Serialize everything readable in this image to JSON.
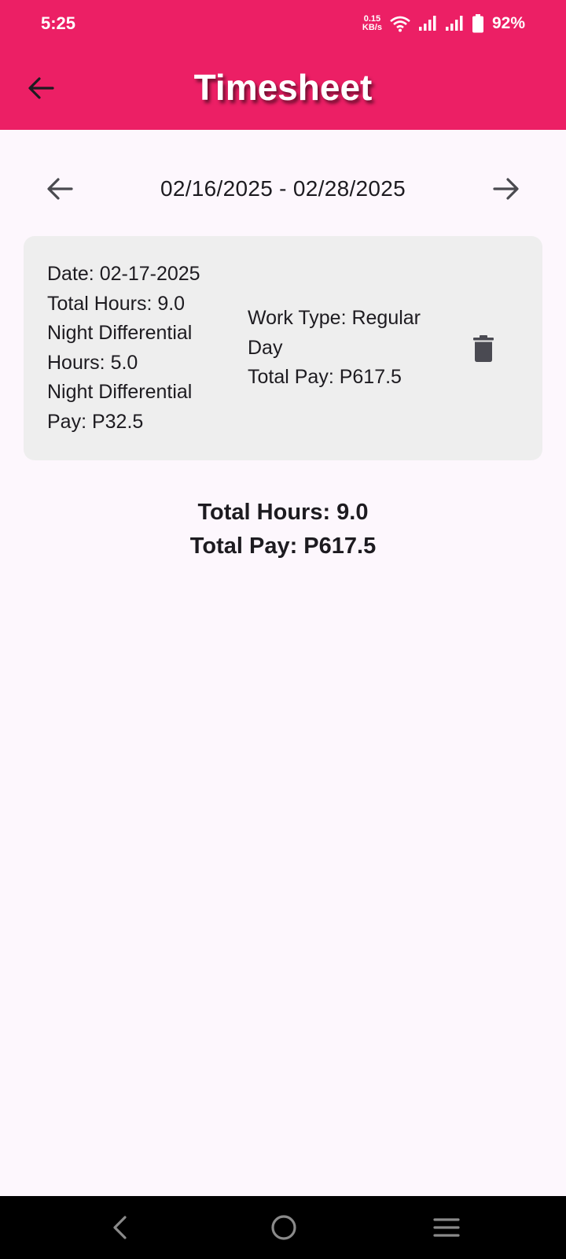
{
  "status_bar": {
    "time": "5:25",
    "net_speed_value": "0.15",
    "net_speed_unit": "KB/s",
    "battery": "92%",
    "icons": [
      "wifi-icon",
      "signal-icon",
      "signal-icon",
      "battery-icon"
    ]
  },
  "header": {
    "title": "Timesheet",
    "back_icon": "arrow-back-icon",
    "background": "#ec1f65"
  },
  "period": {
    "range": "02/16/2025 - 02/28/2025",
    "prev_icon": "arrow-back-icon",
    "next_icon": "arrow-forward-icon"
  },
  "entries": [
    {
      "date": "Date: 02-17-2025",
      "total_hours": "Total Hours: 9.0",
      "nd_hours": "Night Differential Hours: 5.0",
      "nd_pay": "Night Differential Pay: P32.5",
      "work_type": "Work Type: Regular Day",
      "total_pay": "Total Pay: P617.5",
      "delete_icon": "trash-icon"
    }
  ],
  "summary": {
    "total_hours": "Total Hours: 9.0",
    "total_pay": "Total Pay: P617.5"
  },
  "nav_bar": {
    "icons": [
      "back-icon",
      "home-icon",
      "menu-icon"
    ]
  }
}
